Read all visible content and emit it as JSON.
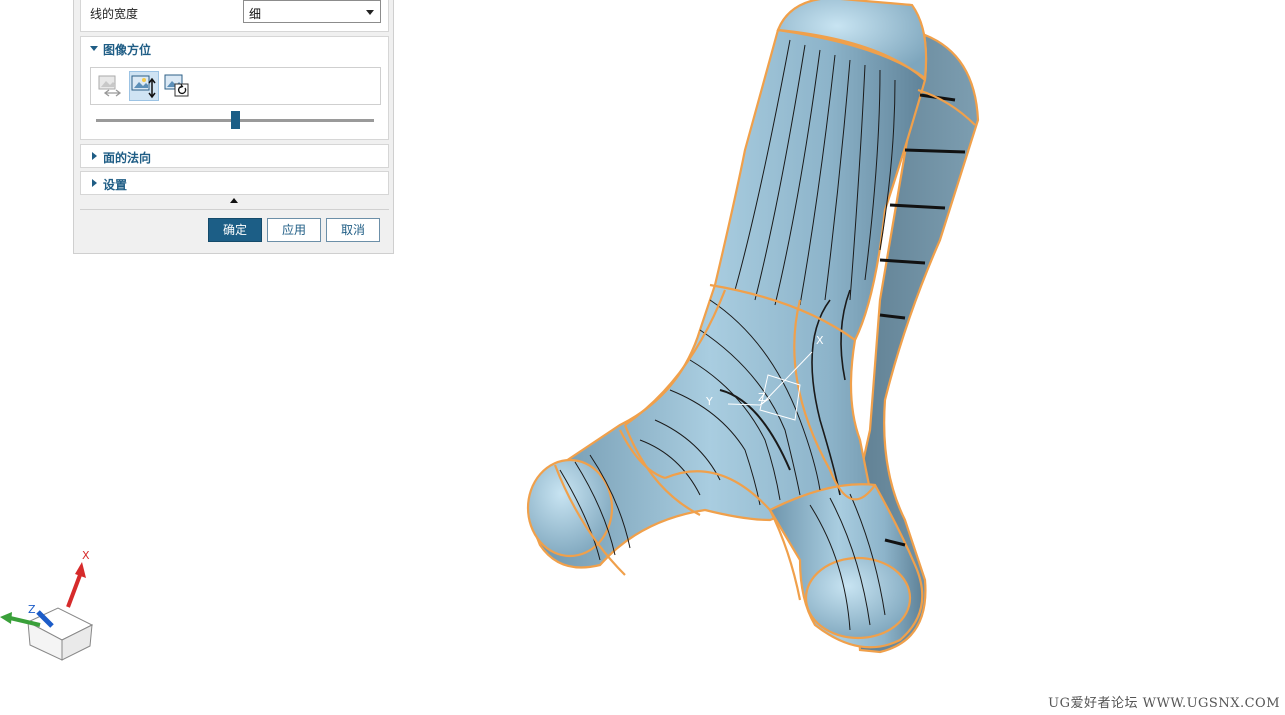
{
  "dialog": {
    "line_width": {
      "label": "线的宽度",
      "value": "细"
    },
    "image_orientation": {
      "title": "图像方位",
      "icons": [
        "image-flip-icon",
        "image-rotate-vertical-icon",
        "image-rotate-icon"
      ],
      "slider_level": 0.5
    },
    "face_normal": {
      "title": "面的法向"
    },
    "settings": {
      "title": "设置"
    },
    "buttons": {
      "ok": "确定",
      "apply": "应用",
      "cancel": "取消"
    }
  },
  "triad": {
    "x_label": "X",
    "z_label": "Z"
  },
  "wcs": {
    "x_label": "X",
    "y_label": "Y",
    "z_label": "Z"
  },
  "watermark": "UG爱好者论坛 WWW.UGSNX.COM",
  "colors": {
    "accent": "#1c5e86",
    "model_surface": "#8fb6cc",
    "edge_highlight": "#f0a04b"
  }
}
